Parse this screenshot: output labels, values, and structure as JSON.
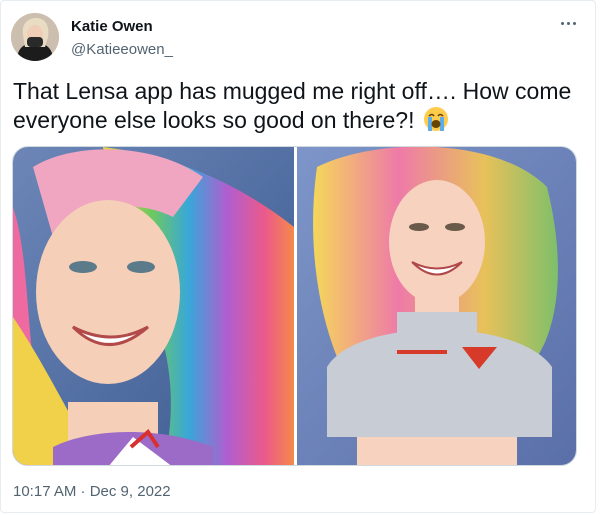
{
  "user": {
    "display_name": "Katie Owen",
    "handle": "@Katieeowen_"
  },
  "tweet": {
    "text": "That Lensa app has mugged me right off…. How come everyone else looks so good on there?!",
    "emoji": "loudly-crying-face-icon",
    "timestamp": "10:17 AM · Dec 9, 2022"
  },
  "colors": {
    "text_primary": "#0f1419",
    "text_secondary": "#536471",
    "border": "#cfd9de"
  }
}
